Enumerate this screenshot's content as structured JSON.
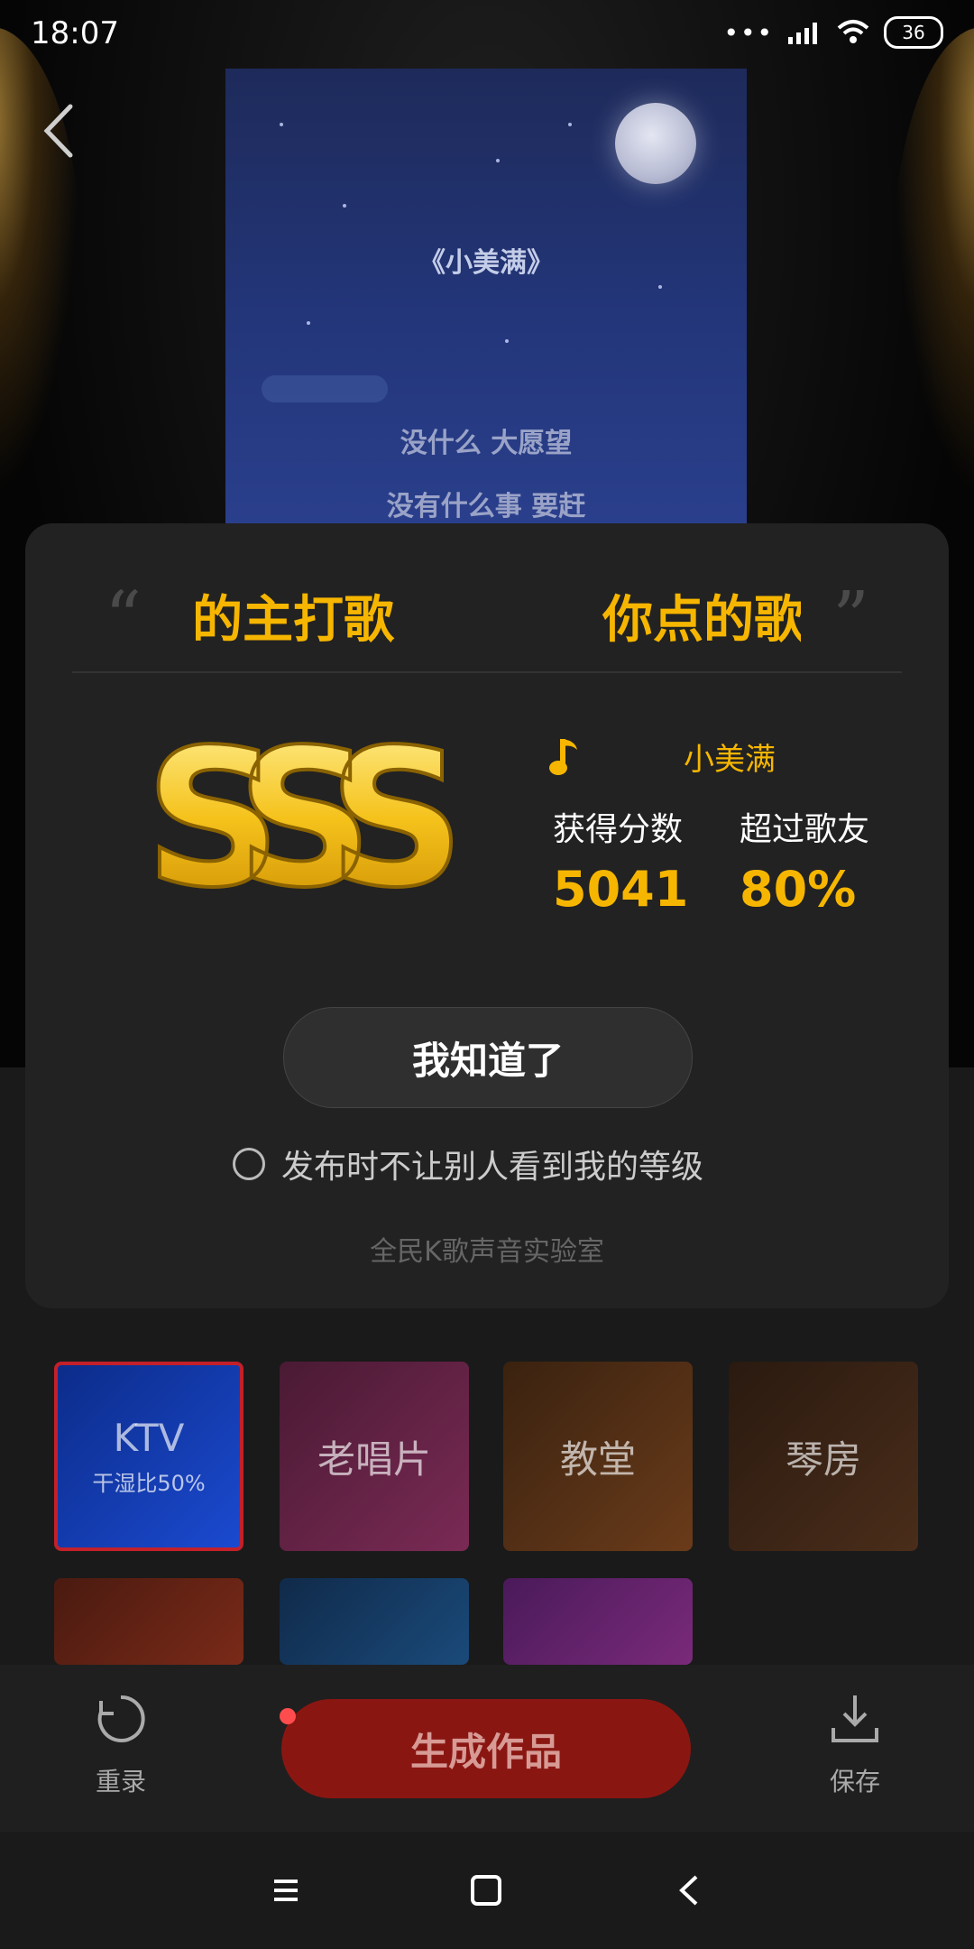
{
  "status_bar": {
    "time": "18:07",
    "dots": "•••",
    "battery": "36"
  },
  "cover": {
    "title": "《小美满》",
    "lines": [
      "没什么 大愿望",
      "没有什么事 要赶"
    ]
  },
  "modal": {
    "ticker": [
      "的主打歌",
      "你点的歌"
    ],
    "grade": "SSS",
    "song_name": "小美满",
    "score_label": "获得分数",
    "score_value": "5041",
    "beat_label": "超过歌友",
    "beat_value": "80%",
    "ok_button": "我知道了",
    "hide_grade_label": "发布时不让别人看到我的等级",
    "lab_label": "全民K歌声音实验室"
  },
  "effects": {
    "tiles": [
      {
        "label": "KTV",
        "sub": "干湿比50%"
      },
      {
        "label": "老唱片"
      },
      {
        "label": "教堂"
      },
      {
        "label": "琴房"
      }
    ]
  },
  "bottom_bar": {
    "redo_label": "重录",
    "generate_label": "生成作品",
    "save_label": "保存"
  },
  "colors": {
    "accent_gold": "#f6b600",
    "generate_red": "#8a1612",
    "modal_bg": "#222222"
  },
  "icons": [
    "back-icon",
    "wifi-icon",
    "signal-icon",
    "music-note-icon",
    "redo-icon",
    "download-icon",
    "menu-icon",
    "home-icon",
    "nav-back-icon"
  ]
}
